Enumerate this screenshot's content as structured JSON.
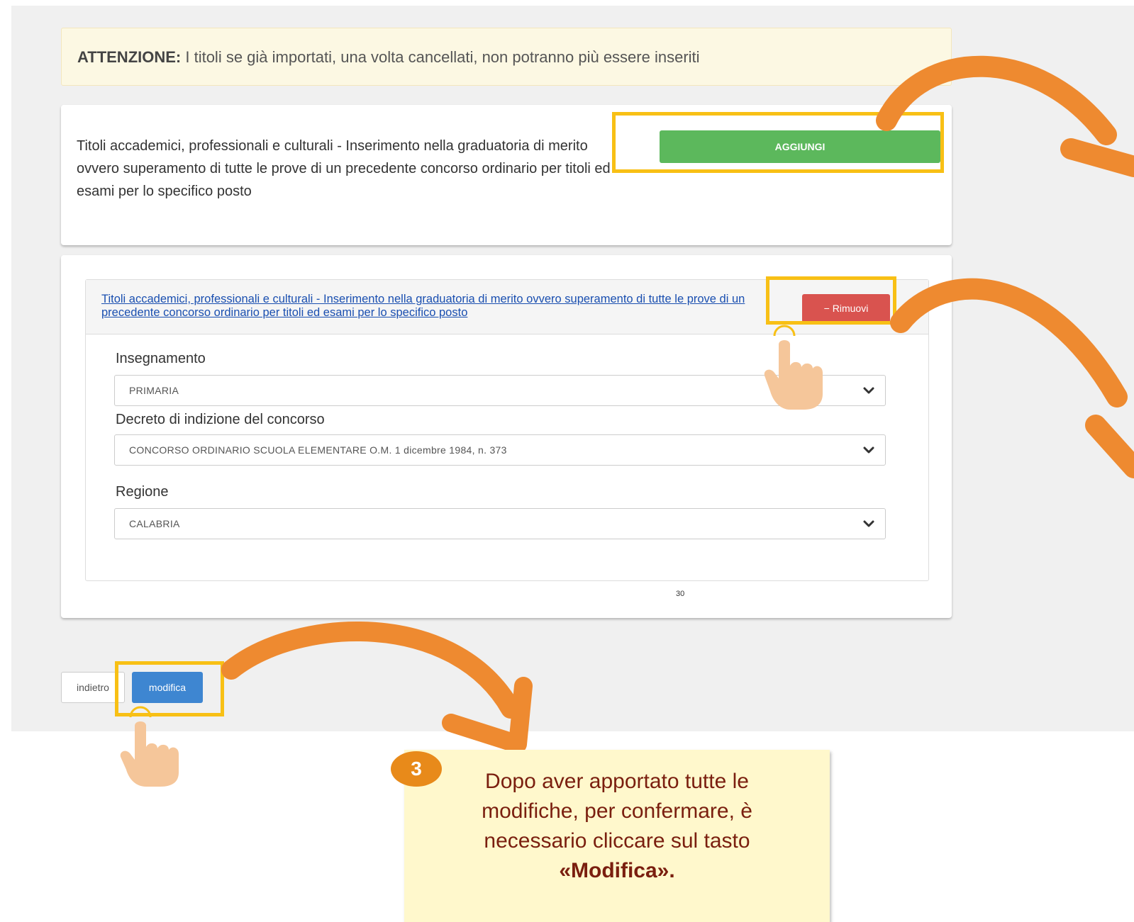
{
  "warning": {
    "strong": "ATTENZIONE:",
    "text": " I titoli se già importati, una volta cancellati, non potranno più essere inseriti"
  },
  "panel1": {
    "description": "Titoli accademici, professionali e culturali - Inserimento nella graduatoria di merito ovvero superamento di tutte le prove di un precedente concorso ordinario per titoli ed esami per lo specifico posto",
    "add_label": "AGGIUNGI"
  },
  "entry": {
    "title": "Titoli accademici, professionali e culturali - Inserimento nella graduatoria di merito ovvero superamento di tutte le prove di un precedente concorso ordinario per titoli ed esami per lo specifico posto",
    "remove_label": "− Rimuovi",
    "fields": [
      {
        "label": "Insegnamento",
        "value": "PRIMARIA"
      },
      {
        "label": "Decreto di indizione del concorso",
        "value": "CONCORSO ORDINARIO SCUOLA ELEMENTARE O.M. 1 dicembre 1984, n. 373"
      },
      {
        "label": "Regione",
        "value": "CALABRIA"
      }
    ]
  },
  "page_number": "30",
  "footer": {
    "back_label": "indietro",
    "modify_label": "modifica"
  },
  "callout": {
    "step": "3",
    "text": "Dopo aver apportato tutte le modifiche, per confermare, è necessario cliccare sul tasto",
    "bold": "«Modifica»."
  },
  "colors": {
    "highlight": "#f8c015",
    "arrow": "#ee8a30",
    "add_button": "#5cb85c",
    "remove_button": "#d9534f",
    "modify_button": "#3e86d1"
  }
}
